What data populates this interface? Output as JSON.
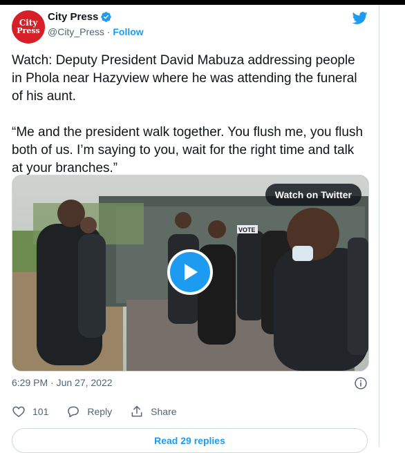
{
  "account": {
    "avatar_line1": "City",
    "avatar_line2": "Press",
    "name": "City Press",
    "handle": "@City_Press",
    "separator": " · ",
    "follow_label": "Follow"
  },
  "tweet": {
    "text": "Watch: Deputy President David Mabuza addressing people in Phola near Hazyview where he was attending the funeral of his aunt.\n\n“Me and the president walk together. You flush me, you flush both of us. I’m saying to you, wait for the right time and talk at your branches.”",
    "timestamp": "6:29 PM · Jun 27, 2022"
  },
  "media": {
    "watch_label": "Watch on Twitter",
    "sign_text": "VOTE"
  },
  "actions": {
    "like_count": "101",
    "reply_label": "Reply",
    "share_label": "Share"
  },
  "replies_label": "Read 29 replies",
  "colors": {
    "accent": "#1d9bf0",
    "brand_red": "#d61f26",
    "text_secondary": "#536471",
    "border": "#cfd9de"
  },
  "icons": [
    "verified-icon",
    "twitter-bird-icon",
    "play-icon",
    "info-icon",
    "heart-icon",
    "reply-icon",
    "share-icon"
  ]
}
